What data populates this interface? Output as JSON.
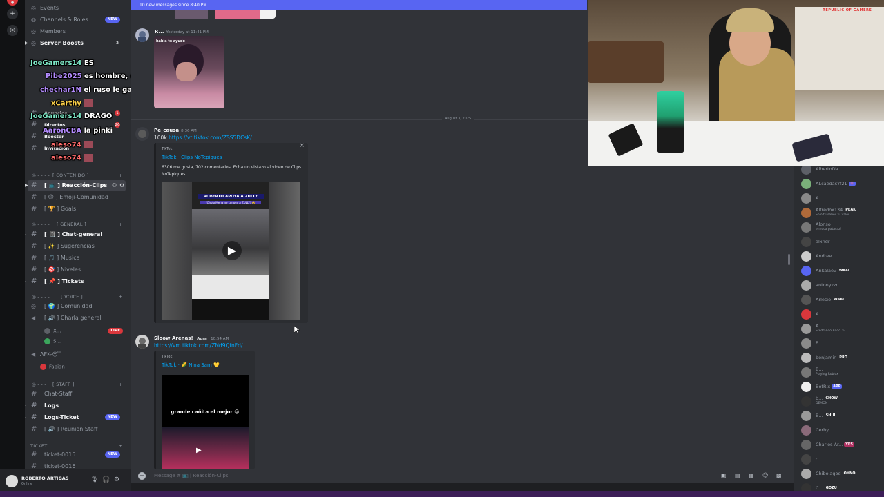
{
  "sidebar": {
    "top_items": [
      {
        "label": "Events",
        "badge": ""
      },
      {
        "label": "Channels & Roles",
        "badge": "NEW"
      },
      {
        "label": "Members",
        "badge": ""
      },
      {
        "label": "Server Boosts",
        "badge": "2"
      }
    ],
    "hidden_channels": [
      {
        "label": "Anuncios",
        "badge": "1"
      },
      {
        "label": "Directos",
        "badge": "26"
      },
      {
        "label": "Booster",
        "badge": ""
      },
      {
        "label": "Invitación",
        "badge": ""
      }
    ],
    "category_contenido": "[ CONTENIDO ]",
    "contenido": [
      {
        "label": "[ 📺 ] Reacción-Clips",
        "active": true
      },
      {
        "label": "[ 😊 ] Emoji-Comunidad",
        "active": false
      },
      {
        "label": "[ 🏆 ] Goals",
        "active": false
      }
    ],
    "category_general": "[ GENERAL ]",
    "general": [
      {
        "label": "[ 📓 ] Chat-general",
        "bold": true
      },
      {
        "label": "[ ✨ ] Sugerencias",
        "bold": false
      },
      {
        "label": "[ 🎵 ] Musica",
        "bold": false
      },
      {
        "label": "[ 🎯 ] Niveles",
        "bold": false
      },
      {
        "label": "[ 📌 ] Tickets",
        "bold": true
      }
    ],
    "category_voice": "[ VOICE ]",
    "voice": [
      {
        "label": "[ 🌍 ] Comunidad"
      },
      {
        "label": "[ 🔊 ] Charla general"
      }
    ],
    "voice_users": [
      "X...",
      "S..."
    ],
    "live_label": "LIVE",
    "afk_label": "AFK-😴",
    "afk_user": "Fabian",
    "category_staff": "[ STAFF ]",
    "staff": [
      {
        "label": "Chat-Staff",
        "bold": false,
        "badge": ""
      },
      {
        "label": "Logs",
        "bold": true,
        "badge": ""
      },
      {
        "label": "Logs-Ticket",
        "bold": true,
        "badge": "NEW"
      },
      {
        "label": "[ 🔊 ] Reunion Staff",
        "bold": false,
        "badge": ""
      }
    ],
    "category_ticket": "TICKET",
    "tickets": [
      {
        "label": "ticket-0015",
        "badge": "NEW"
      },
      {
        "label": "ticket-0016",
        "badge": ""
      }
    ]
  },
  "overlay_chat": [
    {
      "user": "JoeGamers14",
      "color": "#7ee8c7",
      "msg": "ES",
      "emote": false
    },
    {
      "user": "Pibe2025",
      "color": "#b48cff",
      "msg": "es hombre, drago",
      "emote": false
    },
    {
      "user": "chechar1N",
      "color": "#b48cff",
      "msg": "el ruso le gano apolo y rocky se venga",
      "emote": false
    },
    {
      "user": "xCarthy",
      "color": "#ffd24a",
      "msg": "",
      "emote": true
    },
    {
      "user": "JoeGamers14",
      "color": "#7ee8c7",
      "msg": "DRAGO",
      "emote": false
    },
    {
      "user": "AaronCBA",
      "color": "#b48cff",
      "msg": "la pinki",
      "emote": false
    },
    {
      "user": "aleso74",
      "color": "#ff6b6b",
      "msg": "",
      "emote": true
    },
    {
      "user": "aleso74",
      "color": "#ff6b6b",
      "msg": "",
      "emote": true
    }
  ],
  "user_panel": {
    "name": "ROBERTO ARTIGAS",
    "status": "Online"
  },
  "main": {
    "new_messages": "10 new messages since 8:40 PM",
    "msg1": {
      "author": "R...",
      "time": "Yesterday at 11:41 PM",
      "image_caption": "habia te ayudo"
    },
    "date_divider": "August 3, 2025",
    "msg2": {
      "author": "Pe_causa",
      "time": "8:36 AM",
      "text": "100k",
      "link": "https://vt.tiktok.com/ZSS5DCsK/",
      "embed_provider": "TikTok",
      "embed_title": "TikTok · Clips NoTepiques",
      "embed_desc": "6306 me gusta, 702 comentarios. Echa un vistazo al video de Clips NoTepiques.",
      "video_banner": "ROBERTO APOYA A ZULLY",
      "video_sub": "(Cholo Mena no conoce a ZULLY) 🤣"
    },
    "msg3": {
      "author": "Sloow Arenas!",
      "author_tag": "Aura",
      "time": "10:54 AM",
      "link": "https://vm.tiktok.com/ZNd9QfnFd/",
      "embed_provider": "TikTok",
      "embed_title": "TikTok · 🌽 Nina Sam 💛",
      "video_caption": "grande cañita el mejor 😢"
    },
    "message_placeholder": "Message # 📺 | Reacción-Clips"
  },
  "members": [
    {
      "name": "AlbertoDV",
      "status": "",
      "tag": "",
      "tag_color": ""
    },
    {
      "name": "ALcaedasYf21",
      "status": "",
      "tag": "👾",
      "tag_color": "#5865f2"
    },
    {
      "name": "A...",
      "status": "",
      "tag": "",
      "tag_color": ""
    },
    {
      "name": "Alfredox134",
      "status": "Solo tú sabes tu valor",
      "tag": "PEAK",
      "tag_color": "#2b2d31"
    },
    {
      "name": "Alonso",
      "status": "ennoca patasaz!",
      "tag": "",
      "tag_color": ""
    },
    {
      "name": "alxndr",
      "status": "",
      "tag": "",
      "tag_color": ""
    },
    {
      "name": "Andree",
      "status": "",
      "tag": "",
      "tag_color": ""
    },
    {
      "name": "Ankalaev",
      "status": "",
      "tag": "WAAI",
      "tag_color": "#2b2d31"
    },
    {
      "name": "antonyzzr",
      "status": "",
      "tag": "",
      "tag_color": ""
    },
    {
      "name": "Arlesio",
      "status": "",
      "tag": "WAAI",
      "tag_color": "#2b2d31"
    },
    {
      "name": "A...",
      "status": "",
      "tag": "",
      "tag_color": ""
    },
    {
      "name": "A...",
      "status": "Stedfando Ando :'v",
      "tag": "",
      "tag_color": ""
    },
    {
      "name": "B...",
      "status": "",
      "tag": "",
      "tag_color": ""
    },
    {
      "name": "benjamin",
      "status": "",
      "tag": "PRO",
      "tag_color": "#2b2d31"
    },
    {
      "name": "B...",
      "status": "Playing Roblox",
      "tag": "",
      "tag_color": ""
    },
    {
      "name": "BotRix",
      "status": "",
      "tag": "APP",
      "tag_color": "#5865f2"
    },
    {
      "name": "b...",
      "status": "DEMON",
      "tag": "CHOW",
      "tag_color": "#2b2d31"
    },
    {
      "name": "B...",
      "status": "",
      "tag": "SHUL",
      "tag_color": "#2b2d31"
    },
    {
      "name": "Cerhy",
      "status": "",
      "tag": "",
      "tag_color": ""
    },
    {
      "name": "Charles Ar...",
      "status": "",
      "tag": "YES",
      "tag_color": "#b03060"
    },
    {
      "name": "c...",
      "status": "",
      "tag": "",
      "tag_color": ""
    },
    {
      "name": "Chibolagod",
      "status": "",
      "tag": "OHÑO",
      "tag_color": "#2b2d31"
    },
    {
      "name": "C...",
      "status": "",
      "tag": "GOZU",
      "tag_color": "#2b2d31"
    }
  ],
  "webcam_brand": "REPUBLIC OF GAMERS",
  "colors": {
    "accent": "#5865f2",
    "link": "#00a8fc",
    "live": "#da373c"
  }
}
